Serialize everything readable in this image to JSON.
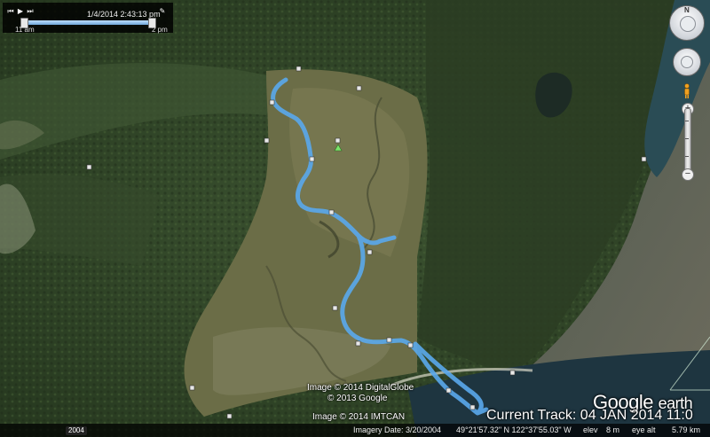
{
  "time_slider": {
    "date_label": "1/4/2014   2:43:13 pm",
    "start_label": "11 am",
    "end_label": "2 pm",
    "position_fraction": 0.97
  },
  "navigation": {
    "north_label": "N",
    "zoom_in": "+",
    "zoom_out": "−"
  },
  "attribution": {
    "line1": "Image © 2014 DigitalGlobe",
    "line2": "© 2013 Google",
    "line3": "Image © 2014 IMTCAN"
  },
  "logo": {
    "word1": "Google",
    "word2": "earth"
  },
  "track_label": "Current Track: 04 JAN 2014 11:0",
  "status": {
    "year": "2004",
    "imagery_date": "Imagery Date: 3/20/2004",
    "coords": "49°21'57.32\" N  122°37'55.03\" W",
    "elev_label": "elev",
    "elev_value": "8 m",
    "eye_alt_label": "eye alt",
    "eye_alt_value": "5.79 km"
  },
  "colors": {
    "track": "#5aa8ec",
    "water": "#1e3540",
    "forest": "#2e4226",
    "valley": "#6c6e48"
  },
  "icons": [
    "play-icon",
    "rewind-icon",
    "forward-icon",
    "wrench-icon",
    "compass-icon",
    "pan-control-icon",
    "pegman-icon",
    "tree-icon",
    "waypoint-icon"
  ]
}
